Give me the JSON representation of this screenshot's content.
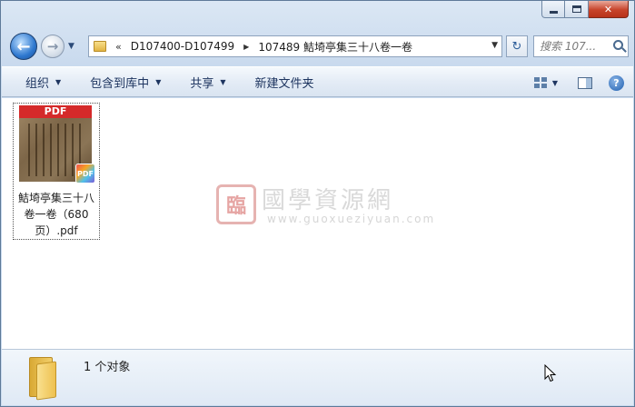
{
  "window": {
    "caption": {
      "close_glyph": "✕"
    }
  },
  "nav": {
    "back_glyph": "←",
    "forward_glyph": "→",
    "history_dropdown_glyph": "▼"
  },
  "address": {
    "overflow_chevron": "«",
    "crumbs": [
      "D107400-D107499",
      "107489 鮚埼亭集三十八卷一卷"
    ],
    "separator": "▶",
    "dropdown_glyph": "▼"
  },
  "refresh": {
    "glyph": "↻"
  },
  "search": {
    "placeholder": "搜索 107..."
  },
  "toolbar": {
    "organize": "组织",
    "include_in_library": "包含到库中",
    "share": "共享",
    "new_folder": "新建文件夹",
    "dropdown_glyph": "▼",
    "help_glyph": "?"
  },
  "files": [
    {
      "thumb_band": "PDF",
      "badge": "PDF",
      "name": "鮚埼亭集三十八卷一卷（680页）.pdf"
    }
  ],
  "watermark": {
    "logo_glyph": "臨",
    "title": "國學資源網",
    "url": "www.guoxueziyuan.com"
  },
  "details": {
    "count": "1 个对象"
  },
  "colors": {
    "accent": "#2e78cf",
    "close": "#c7432a",
    "pdf_red": "#d52a2a"
  }
}
